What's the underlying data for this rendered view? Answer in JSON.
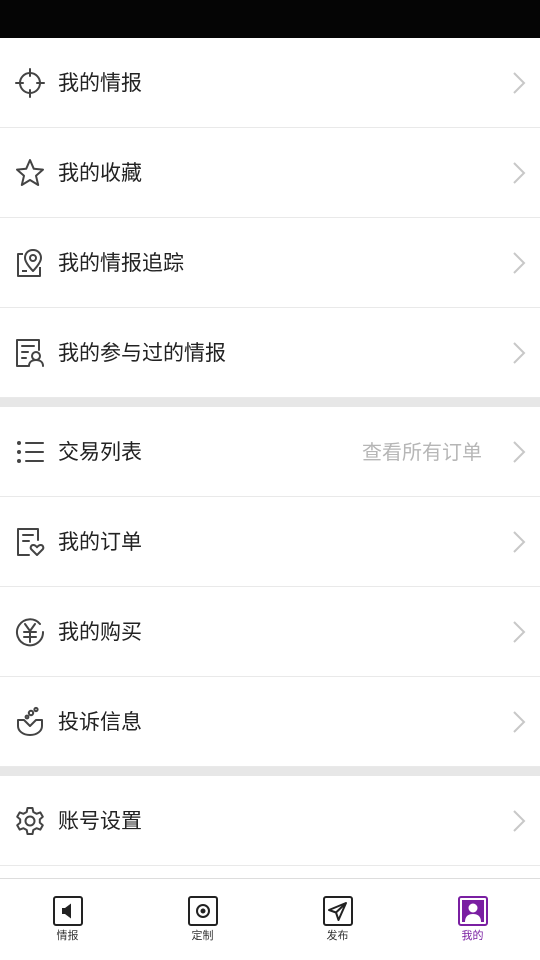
{
  "colors": {
    "accent": "#7a1fa2",
    "text": "#222222",
    "hint": "#b6b6b6",
    "divider": "#e9e9e9",
    "section_gap": "#e7e7e7"
  },
  "menu": {
    "group1": [
      {
        "label": "我的情报",
        "icon": "crosshair-icon"
      },
      {
        "label": "我的收藏",
        "icon": "star-icon"
      },
      {
        "label": "我的情报追踪",
        "icon": "location-pin-icon"
      },
      {
        "label": "我的参与过的情报",
        "icon": "document-user-icon"
      }
    ],
    "group2": [
      {
        "label": "交易列表",
        "icon": "list-icon",
        "hint": "查看所有订单"
      },
      {
        "label": "我的订单",
        "icon": "order-heart-icon"
      },
      {
        "label": "我的购买",
        "icon": "yuan-coin-icon"
      },
      {
        "label": "投诉信息",
        "icon": "complaint-icon"
      }
    ],
    "group3": [
      {
        "label": "账号设置",
        "icon": "gear-icon"
      }
    ]
  },
  "tabbar": {
    "tabs": [
      {
        "label": "情报",
        "icon": "speaker-icon",
        "active": false
      },
      {
        "label": "定制",
        "icon": "record-icon",
        "active": false
      },
      {
        "label": "发布",
        "icon": "paper-plane-icon",
        "active": false
      },
      {
        "label": "我的",
        "icon": "user-profile-icon",
        "active": true
      }
    ]
  }
}
